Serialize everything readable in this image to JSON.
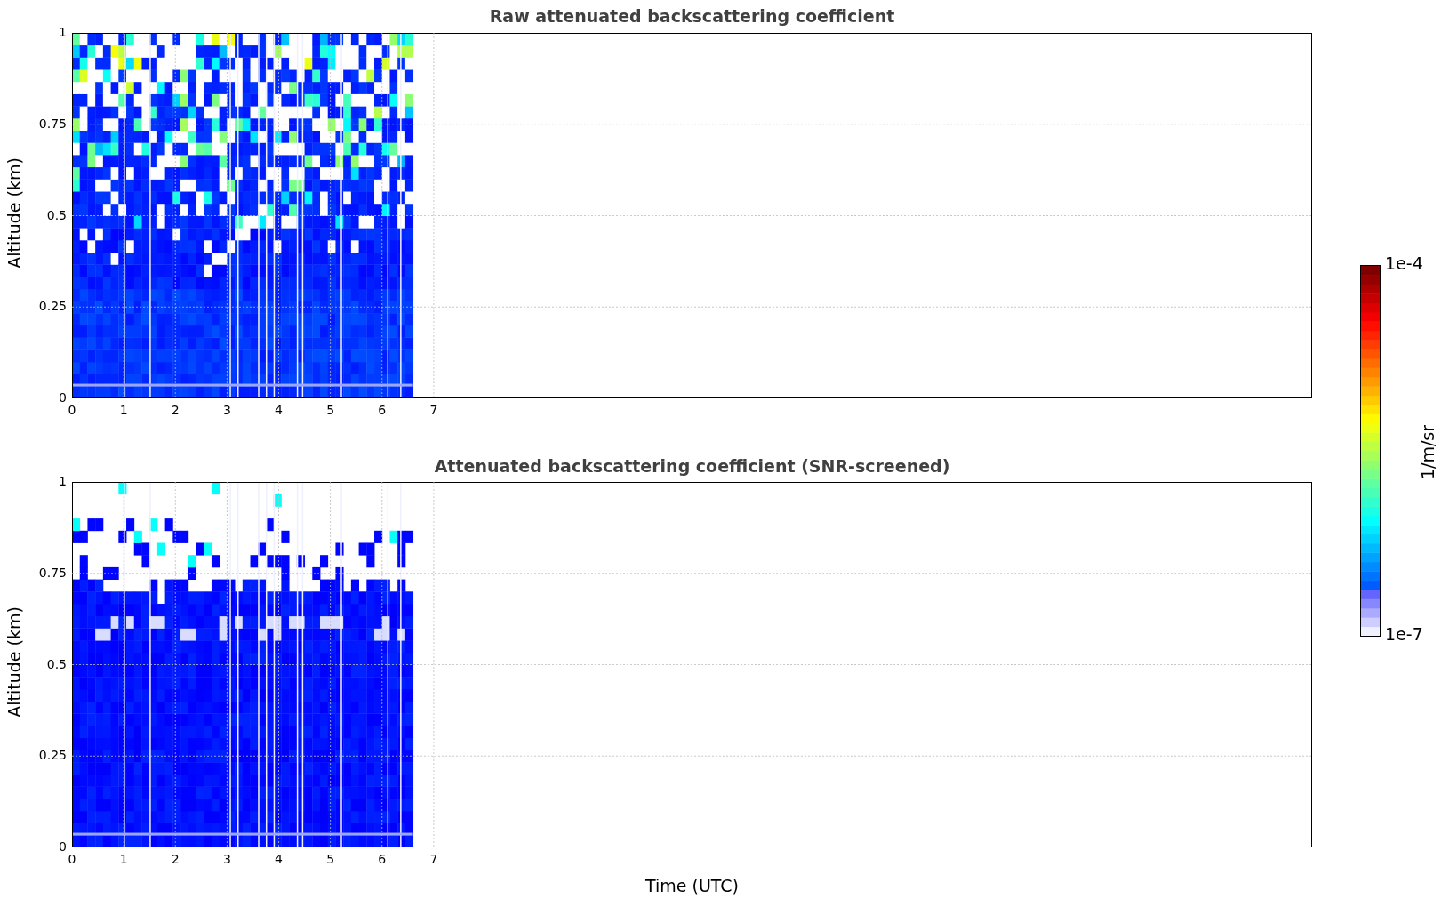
{
  "panels": [
    {
      "kind": "raw",
      "title": "Raw attenuated backscattering coefficient",
      "ylabel": "Altitude (km)",
      "yticks": [
        "1",
        "0.75",
        "0.5",
        "0.25",
        "0"
      ],
      "xticks": [
        "0",
        "1",
        "2",
        "3",
        "4",
        "5",
        "6",
        "7"
      ]
    },
    {
      "kind": "screened",
      "title": "Attenuated backscattering coefficient (SNR-screened)",
      "ylabel": "Altitude (km)",
      "yticks": [
        "1",
        "0.75",
        "0.5",
        "0.25",
        "0"
      ],
      "xticks": [
        "0",
        "1",
        "2",
        "3",
        "4",
        "5",
        "6",
        "7"
      ]
    }
  ],
  "xlabel": "Time (UTC)",
  "colorbar": {
    "label": "1/m/sr",
    "max": "1e-4",
    "min": "1e-7"
  }
}
